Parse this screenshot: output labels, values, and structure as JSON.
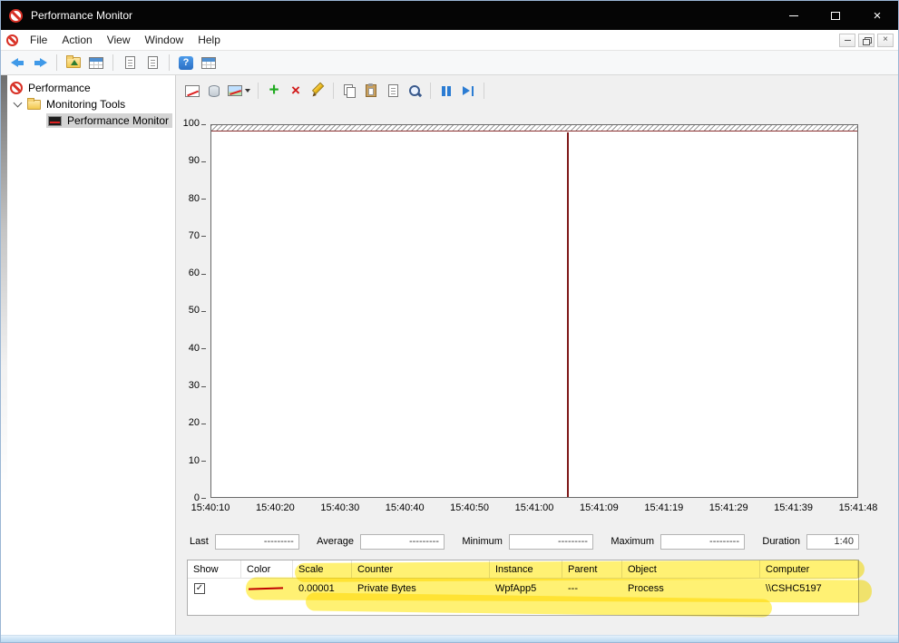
{
  "window": {
    "title": "Performance Monitor"
  },
  "menu": {
    "items": [
      "File",
      "Action",
      "View",
      "Window",
      "Help"
    ]
  },
  "icons": {
    "add": "+",
    "delete": "×",
    "close": "×",
    "help": "?",
    "check": "✓"
  },
  "tree": {
    "root_label": "Performance",
    "monitoring_tools_label": "Monitoring Tools",
    "performance_monitor_label": "Performance Monitor"
  },
  "chart": {
    "type": "line",
    "y_ticks": [
      "100",
      "90",
      "80",
      "70",
      "60",
      "50",
      "40",
      "30",
      "20",
      "10",
      "0"
    ],
    "x_ticks": [
      "15:40:10",
      "15:40:20",
      "15:40:30",
      "15:40:40",
      "15:40:50",
      "15:41:00",
      "15:41:09",
      "15:41:19",
      "15:41:29",
      "15:41:39",
      "15:41:48"
    ],
    "ylim": [
      0,
      100
    ],
    "timeline_color": "#7e1818",
    "series": [
      {
        "name": "Private Bytes",
        "color": "#c00000",
        "values": []
      }
    ]
  },
  "stats": {
    "last_label": "Last",
    "last_value": "---------",
    "average_label": "Average",
    "average_value": "---------",
    "minimum_label": "Minimum",
    "minimum_value": "---------",
    "maximum_label": "Maximum",
    "maximum_value": "---------",
    "duration_label": "Duration",
    "duration_value": "1:40"
  },
  "legend": {
    "columns": [
      "Show",
      "Color",
      "Scale",
      "Counter",
      "Instance",
      "Parent",
      "Object",
      "Computer"
    ],
    "row": {
      "checked": true,
      "color": "#c00000",
      "scale": "0.00001",
      "counter": "Private Bytes",
      "instance": "WpfApp5",
      "parent": "---",
      "object": "Process",
      "computer": "\\\\CSHC5197"
    }
  },
  "annotation": {
    "highlight_color": "#ffe600"
  }
}
